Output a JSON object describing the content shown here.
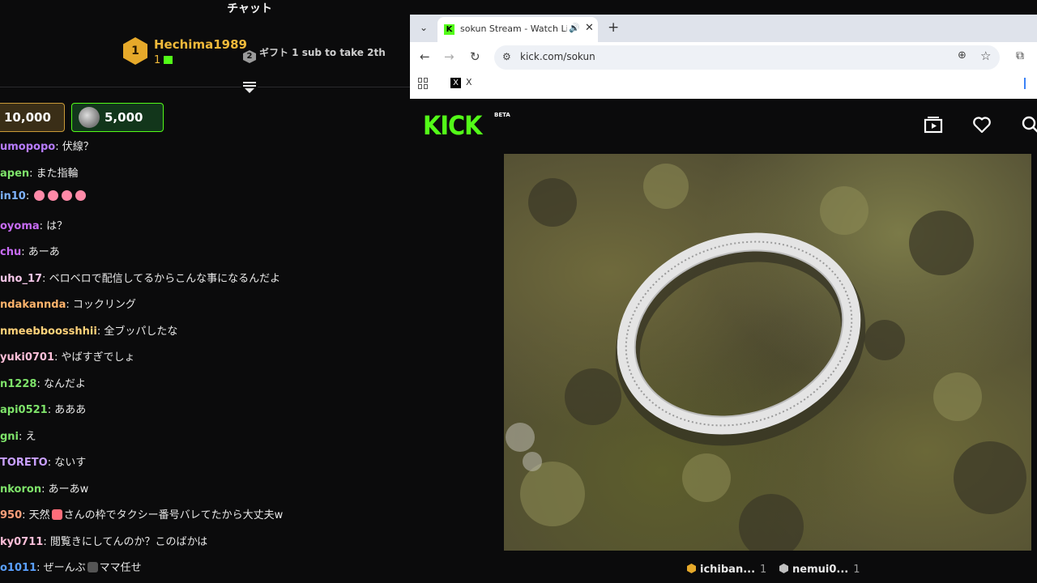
{
  "chat": {
    "title": "チャット",
    "leader": {
      "rank": "1",
      "name": "Hechima1989",
      "count": "1"
    },
    "second": {
      "rank": "2",
      "text": "ギフト 1 sub to take 2th"
    },
    "pinned": [
      {
        "amount": "10,000",
        "color": "#c99a37"
      },
      {
        "amount": "5,000",
        "color": "#53fc18"
      }
    ],
    "messages": [
      {
        "user": "umopopo",
        "color": "#b77cff",
        "text": "伏線？"
      },
      {
        "user": "apen",
        "color": "#7ee36a",
        "text": "また指輪"
      },
      {
        "user": "in10",
        "color": "#7fb3ff",
        "text": ""
      },
      {
        "user": "oyoma",
        "color": "#c86cf5",
        "text": "は？"
      },
      {
        "user": "chu",
        "color": "#c86cf5",
        "text": "あーあ"
      },
      {
        "user": "uho_17",
        "color": "#f5c6e8",
        "text": "ベロベロで配信してるからこんな事になるんだよ"
      },
      {
        "user": "ndakannda",
        "color": "#ffb36b",
        "text": "コックリング"
      },
      {
        "user": "nmeebboosshhii",
        "color": "#ffd27a",
        "text": "全ブッパしたな"
      },
      {
        "user": "yuki0701",
        "color": "#ffbfd9",
        "text": "やばすぎでしょ"
      },
      {
        "user": "n1228",
        "color": "#7ee36a",
        "text": "なんだよ"
      },
      {
        "user": "api0521",
        "color": "#7ee36a",
        "text": "あああ"
      },
      {
        "user": "gni",
        "color": "#7ee36a",
        "text": "え"
      },
      {
        "user": "TORETO",
        "color": "#c9a0ff",
        "text": "ないす"
      },
      {
        "user": "nkoron",
        "color": "#7ee36a",
        "text": "あーあw"
      },
      {
        "user": "950",
        "color": "#ff9f7a",
        "text_a": "天然",
        "text_b": "さんの枠でタクシー番号バレてたから大丈夫w"
      },
      {
        "user": "ky0711",
        "color": "#ffbfd9",
        "text": "閲覧きにしてんのか？このばかは"
      },
      {
        "user": "o1011",
        "color": "#5aa0ff",
        "text_a": "ぜーんぶ",
        "text_b": "ママ任せ"
      }
    ]
  },
  "browser": {
    "tab_title": "sokun Stream - Watch Live on",
    "url": "kick.com/sokun",
    "bookmark_label": "X",
    "icons": [
      "chevron-down-icon",
      "speaker-icon",
      "close-icon",
      "plus-icon",
      "back-icon",
      "forward-icon",
      "reload-icon",
      "site-info-icon",
      "zoom-icon",
      "star-icon",
      "extensions-icon",
      "apps-icon"
    ]
  },
  "kick": {
    "logo": "KICK",
    "beta": "BETA",
    "accent": "#53fc18",
    "viewers": [
      {
        "name": "ichiban...",
        "count": "1",
        "color": "#e6a92a"
      },
      {
        "name": "nemui0...",
        "count": "1",
        "color": "#c0c0c0"
      }
    ]
  }
}
